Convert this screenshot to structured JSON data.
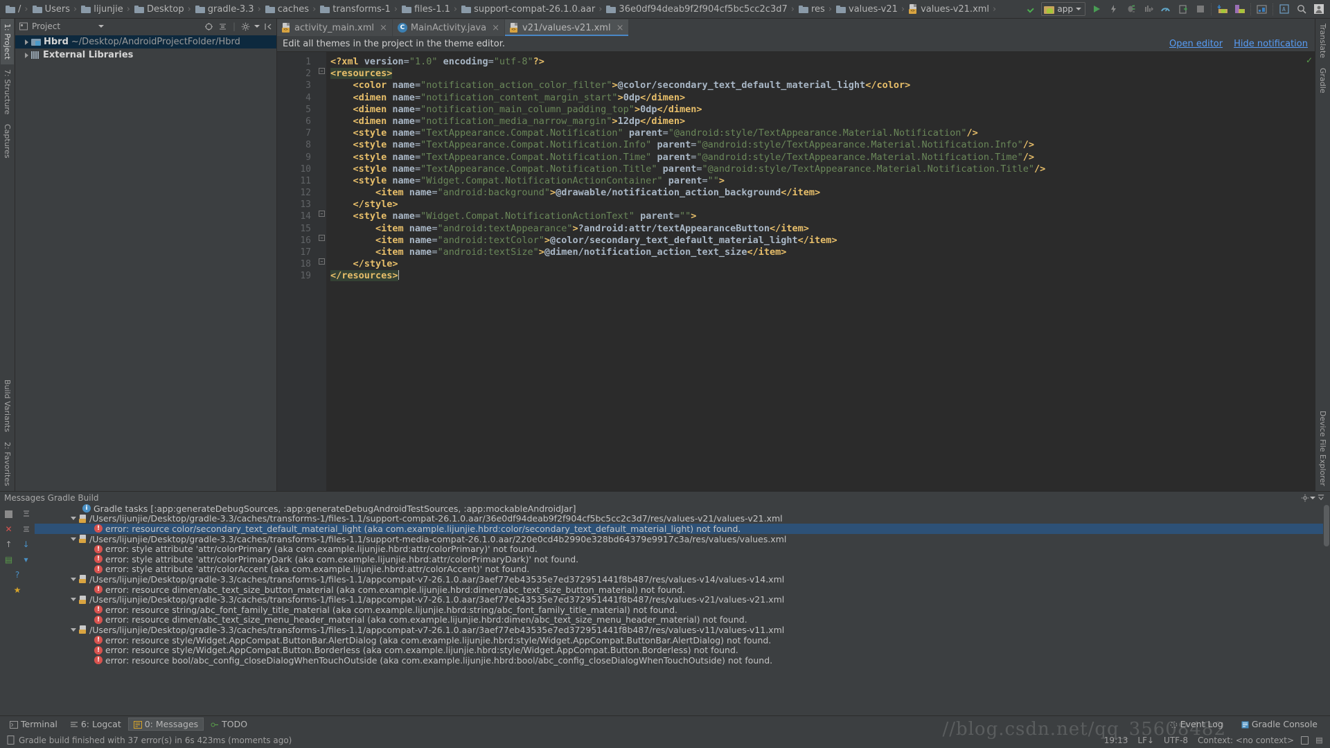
{
  "breadcrumb": {
    "items": [
      {
        "label": "/",
        "icon": "folder-icon"
      },
      {
        "label": "Users",
        "icon": "folder-icon"
      },
      {
        "label": "lijunjie",
        "icon": "folder-icon"
      },
      {
        "label": "Desktop",
        "icon": "folder-icon"
      },
      {
        "label": "gradle-3.3",
        "icon": "folder-icon"
      },
      {
        "label": "caches",
        "icon": "folder-icon"
      },
      {
        "label": "transforms-1",
        "icon": "folder-icon"
      },
      {
        "label": "files-1.1",
        "icon": "folder-icon"
      },
      {
        "label": "support-compat-26.1.0.aar",
        "icon": "folder-icon"
      },
      {
        "label": "36e0df94deab9f2f904cf5bc5cc2c3d7",
        "icon": "folder-icon"
      },
      {
        "label": "res",
        "icon": "folder-icon"
      },
      {
        "label": "values-v21",
        "icon": "folder-icon"
      },
      {
        "label": "values-v21.xml",
        "icon": "xml-file-icon"
      }
    ],
    "separator": "›"
  },
  "toolbar": {
    "module_label": "app",
    "buttons": [
      {
        "name": "sync-project-button",
        "glyph": "↖"
      },
      {
        "name": "run-button",
        "glyph": "▶"
      },
      {
        "name": "apply-changes-button",
        "glyph": "⚡"
      },
      {
        "name": "debug-button",
        "glyph": "🐞"
      },
      {
        "name": "run-with-coverage-button",
        "glyph": "‖"
      },
      {
        "name": "profiler-button",
        "glyph": "◔"
      },
      {
        "name": "attach-debugger-button",
        "glyph": "▧"
      },
      {
        "name": "stop-button",
        "glyph": "■"
      },
      {
        "name": "sync-gradle-button",
        "glyph": "⬇"
      },
      {
        "name": "avd-manager-button",
        "glyph": "▣"
      },
      {
        "name": "sdk-manager-button",
        "glyph": "▦"
      },
      {
        "name": "layout-inspector-button",
        "glyph": "Ⓐ"
      },
      {
        "name": "search-everywhere-button",
        "glyph": "⌕"
      },
      {
        "name": "user-account-button",
        "glyph": "👤"
      }
    ]
  },
  "left_strips": {
    "top": [
      {
        "label": "1: Project",
        "active": true
      },
      {
        "label": "7: Structure",
        "active": false
      },
      {
        "label": "Captures",
        "active": false
      }
    ],
    "bottom": [
      {
        "label": "Build Variants",
        "active": false
      },
      {
        "label": "2: Favorites",
        "active": false
      }
    ]
  },
  "right_strips": {
    "top": [
      {
        "label": "Translate",
        "active": false
      },
      {
        "label": "Gradle",
        "active": false
      }
    ],
    "bottom": [
      {
        "label": "Device File Explorer",
        "active": false
      }
    ]
  },
  "project_panel": {
    "title": "Project",
    "toolbar_icons": [
      "target-icon",
      "collapse-all-icon",
      "gear-icon",
      "hide-icon"
    ],
    "tree": [
      {
        "name": "Hbrd",
        "path": "~/Desktop/AndroidProjectFolder/Hbrd",
        "selected": true,
        "icon": "module-icon",
        "expandable": true
      },
      {
        "name": "External Libraries",
        "path": "",
        "selected": false,
        "icon": "library-icon",
        "expandable": true
      }
    ]
  },
  "editor": {
    "tabs": [
      {
        "label": "activity_main.xml",
        "icon": "xml-file-icon",
        "active": false,
        "close": "×"
      },
      {
        "label": "MainActivity.java",
        "icon": "java-file-icon",
        "active": false,
        "close": "×"
      },
      {
        "label": "v21/values-v21.xml",
        "icon": "xml-file-icon",
        "active": true,
        "close": "×"
      }
    ],
    "notification": {
      "message": "Edit all themes in the project in the theme editor.",
      "links": [
        "Open editor",
        "Hide notification"
      ]
    },
    "line_numbers": [
      1,
      2,
      3,
      4,
      5,
      6,
      7,
      8,
      9,
      10,
      11,
      12,
      13,
      14,
      15,
      16,
      17,
      18,
      19
    ],
    "lines": [
      "<?xml version=\"1.0\" encoding=\"utf-8\"?>",
      "<resources>",
      "    <color name=\"notification_action_color_filter\">@color/secondary_text_default_material_light</color>",
      "    <dimen name=\"notification_content_margin_start\">0dp</dimen>",
      "    <dimen name=\"notification_main_column_padding_top\">0dp</dimen>",
      "    <dimen name=\"notification_media_narrow_margin\">12dp</dimen>",
      "    <style name=\"TextAppearance.Compat.Notification\" parent=\"@android:style/TextAppearance.Material.Notification\"/>",
      "    <style name=\"TextAppearance.Compat.Notification.Info\" parent=\"@android:style/TextAppearance.Material.Notification.Info\"/>",
      "    <style name=\"TextAppearance.Compat.Notification.Time\" parent=\"@android:style/TextAppearance.Material.Notification.Time\"/>",
      "    <style name=\"TextAppearance.Compat.Notification.Title\" parent=\"@android:style/TextAppearance.Material.Notification.Title\"/>",
      "    <style name=\"Widget.Compat.NotificationActionContainer\" parent=\"\">",
      "        <item name=\"android:background\">@drawable/notification_action_background</item>",
      "    </style>",
      "    <style name=\"Widget.Compat.NotificationActionText\" parent=\"\">",
      "        <item name=\"android:textAppearance\">?android:attr/textAppearanceButton</item>",
      "        <item name=\"android:textColor\">@color/secondary_text_default_material_light</item>",
      "        <item name=\"android:textSize\">@dimen/notification_action_text_size</item>",
      "    </style>",
      "</resources>"
    ]
  },
  "messages_panel": {
    "title": "Messages Gradle Build",
    "rows": [
      {
        "indent": 1,
        "icon": "info-icon",
        "type": "info",
        "text": "Gradle tasks [:app:generateDebugSources, :app:generateDebugAndroidTestSources, :app:mockableAndroidJar]",
        "selected": false,
        "arrow": false
      },
      {
        "indent": 0,
        "icon": "xml-file-icon",
        "type": "file",
        "text": "/Users/lijunjie/Desktop/gradle-3.3/caches/transforms-1/files-1.1/support-compat-26.1.0.aar/36e0df94deab9f2f904cf5bc5cc2c3d7/res/values-v21/values-v21.xml",
        "selected": false,
        "arrow": true
      },
      {
        "indent": 2,
        "icon": "error-icon",
        "type": "error",
        "text": "error: resource color/secondary_text_default_material_light (aka com.example.lijunjie.hbrd:color/secondary_text_default_material_light) not found.",
        "selected": true,
        "arrow": false
      },
      {
        "indent": 0,
        "icon": "xml-file-icon",
        "type": "file",
        "text": "/Users/lijunjie/Desktop/gradle-3.3/caches/transforms-1/files-1.1/support-media-compat-26.1.0.aar/220e0cd4b2990e328bd64379e9917c3a/res/values/values.xml",
        "selected": false,
        "arrow": true
      },
      {
        "indent": 2,
        "icon": "error-icon",
        "type": "error",
        "text": "error: style attribute 'attr/colorPrimary (aka com.example.lijunjie.hbrd:attr/colorPrimary)' not found.",
        "selected": false,
        "arrow": false
      },
      {
        "indent": 2,
        "icon": "error-icon",
        "type": "error",
        "text": "error: style attribute 'attr/colorPrimaryDark (aka com.example.lijunjie.hbrd:attr/colorPrimaryDark)' not found.",
        "selected": false,
        "arrow": false
      },
      {
        "indent": 2,
        "icon": "error-icon",
        "type": "error",
        "text": "error: style attribute 'attr/colorAccent (aka com.example.lijunjie.hbrd:attr/colorAccent)' not found.",
        "selected": false,
        "arrow": false
      },
      {
        "indent": 0,
        "icon": "xml-file-icon",
        "type": "file",
        "text": "/Users/lijunjie/Desktop/gradle-3.3/caches/transforms-1/files-1.1/appcompat-v7-26.1.0.aar/3aef77eb43535e7ed372951441f8b487/res/values-v14/values-v14.xml",
        "selected": false,
        "arrow": true
      },
      {
        "indent": 2,
        "icon": "error-icon",
        "type": "error",
        "text": "error: resource dimen/abc_text_size_button_material (aka com.example.lijunjie.hbrd:dimen/abc_text_size_button_material) not found.",
        "selected": false,
        "arrow": false
      },
      {
        "indent": 0,
        "icon": "xml-file-icon",
        "type": "file",
        "text": "/Users/lijunjie/Desktop/gradle-3.3/caches/transforms-1/files-1.1/appcompat-v7-26.1.0.aar/3aef77eb43535e7ed372951441f8b487/res/values-v21/values-v21.xml",
        "selected": false,
        "arrow": true
      },
      {
        "indent": 2,
        "icon": "error-icon",
        "type": "error",
        "text": "error: resource string/abc_font_family_title_material (aka com.example.lijunjie.hbrd:string/abc_font_family_title_material) not found.",
        "selected": false,
        "arrow": false
      },
      {
        "indent": 2,
        "icon": "error-icon",
        "type": "error",
        "text": "error: resource dimen/abc_text_size_menu_header_material (aka com.example.lijunjie.hbrd:dimen/abc_text_size_menu_header_material) not found.",
        "selected": false,
        "arrow": false
      },
      {
        "indent": 0,
        "icon": "xml-file-icon",
        "type": "file",
        "text": "/Users/lijunjie/Desktop/gradle-3.3/caches/transforms-1/files-1.1/appcompat-v7-26.1.0.aar/3aef77eb43535e7ed372951441f8b487/res/values-v11/values-v11.xml",
        "selected": false,
        "arrow": true
      },
      {
        "indent": 2,
        "icon": "error-icon",
        "type": "error",
        "text": "error: resource style/Widget.AppCompat.ButtonBar.AlertDialog (aka com.example.lijunjie.hbrd:style/Widget.AppCompat.ButtonBar.AlertDialog) not found.",
        "selected": false,
        "arrow": false
      },
      {
        "indent": 2,
        "icon": "error-icon",
        "type": "error",
        "text": "error: resource style/Widget.AppCompat.Button.Borderless (aka com.example.lijunjie.hbrd:style/Widget.AppCompat.Button.Borderless) not found.",
        "selected": false,
        "arrow": false
      },
      {
        "indent": 2,
        "icon": "error-icon",
        "type": "error",
        "text": "error: resource bool/abc_config_closeDialogWhenTouchOutside (aka com.example.lijunjie.hbrd:bool/abc_config_closeDialogWhenTouchOutside) not found.",
        "selected": false,
        "arrow": false
      }
    ]
  },
  "bottom_tabs": [
    {
      "label": "Terminal",
      "icon": "terminal-icon",
      "active": false
    },
    {
      "label": "6: Logcat",
      "icon": "logcat-icon",
      "active": false
    },
    {
      "label": "0: Messages",
      "icon": "messages-icon",
      "active": true
    },
    {
      "label": "TODO",
      "icon": "todo-icon",
      "active": false
    }
  ],
  "bottom_right_tabs": [
    {
      "label": "Event Log",
      "icon": "event-log-icon"
    },
    {
      "label": "Gradle Console",
      "icon": "gradle-console-icon"
    }
  ],
  "statusbar": {
    "message": "Gradle build finished with 37 error(s) in 6s 423ms (moments ago)",
    "caret": "19:13",
    "line_sep": "LF↓",
    "encoding": "UTF-8",
    "context": "Context: <no context>",
    "lock_icon": "lock-icon"
  },
  "watermark": "//blog.csdn.net/qq_35608482"
}
